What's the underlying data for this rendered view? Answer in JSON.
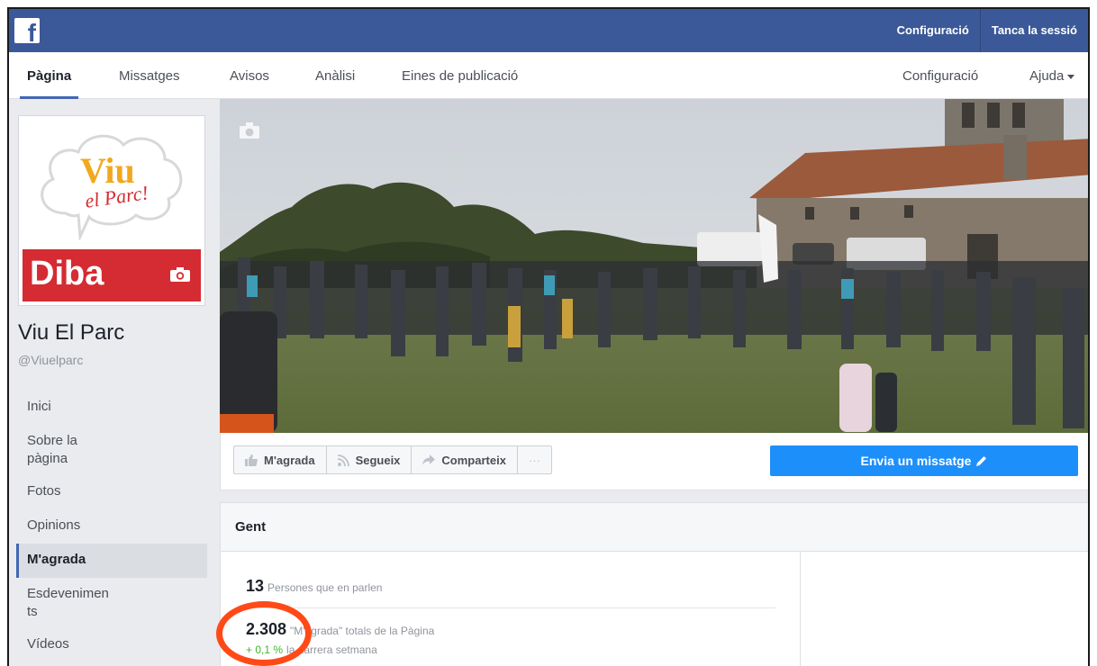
{
  "topbar": {
    "logo": "f",
    "links": [
      "Configuració",
      "Tanca la sessió"
    ]
  },
  "pagenav": {
    "tabs": [
      "Pàgina",
      "Missatges",
      "Avisos",
      "Anàlisi",
      "Eines de publicació"
    ],
    "right": [
      "Configuració",
      "Ajuda"
    ]
  },
  "profile": {
    "logo_line1": "Viu",
    "logo_line2": "el Parc!",
    "brand": "Diba",
    "name": "Viu El Parc",
    "handle": "@Viuelparc"
  },
  "leftnav": {
    "items": [
      "Inici",
      "Sobre la pàgina",
      "Fotos",
      "Opinions",
      "M'agrada",
      "Esdeveniments",
      "Vídeos"
    ],
    "active": "M'agrada"
  },
  "actions": {
    "like": "M'agrada",
    "follow": "Segueix",
    "share": "Comparteix",
    "more": "···",
    "message": "Envia un missatge"
  },
  "people": {
    "title": "Gent",
    "talking_count": "13",
    "talking_label": "Persones que en parlen",
    "likes_count": "2.308",
    "likes_label": "\"M'agrada\" totals de la Pàgina",
    "growth_pct": "+ 0,1 %",
    "growth_label": "la darrera setmana"
  },
  "colors": {
    "facebook_blue": "#3b5998",
    "message_button": "#1d8ffb",
    "diba_red": "#d52b32",
    "highlight_oval": "#ff4a17",
    "growth_green": "#42b72a"
  }
}
